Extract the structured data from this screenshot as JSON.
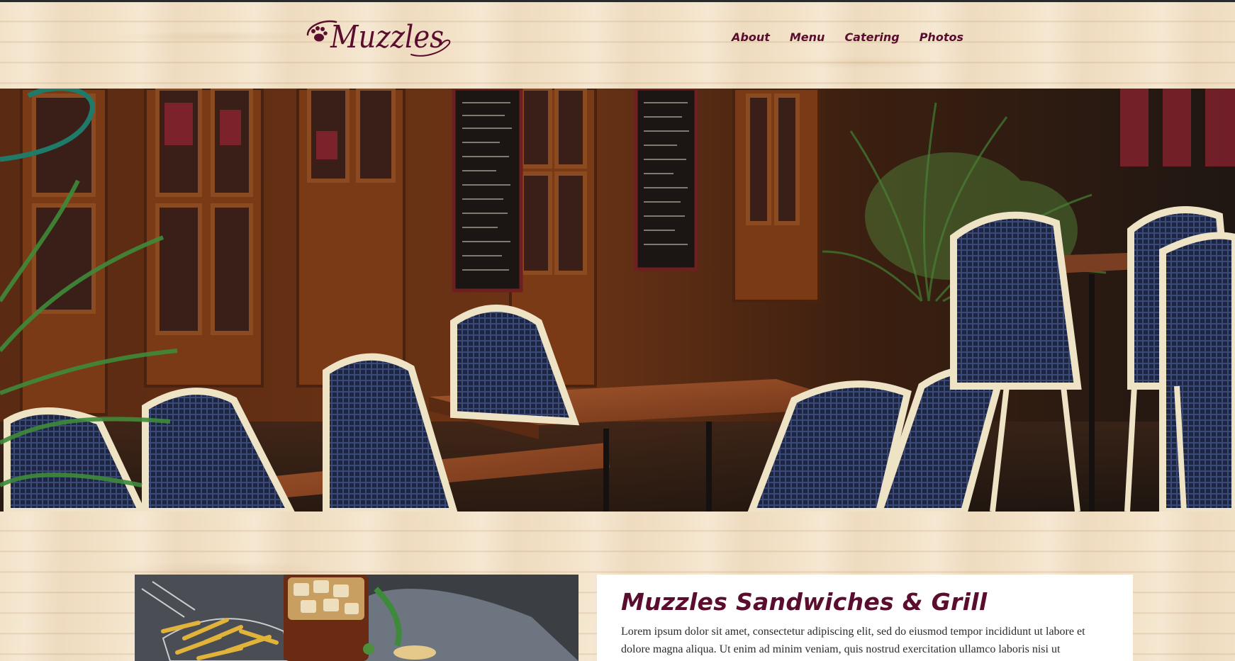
{
  "brand": {
    "name": "Muzzles",
    "color": "#5a0d2e",
    "logo_icon": "paw-print-icon"
  },
  "nav": {
    "items": [
      {
        "label": "About"
      },
      {
        "label": "Menu"
      },
      {
        "label": "Catering"
      },
      {
        "label": "Photos"
      }
    ]
  },
  "hero": {
    "image": "outdoor-cafe-terrace-photo"
  },
  "intro": {
    "title": "Muzzles Sandwiches & Grill",
    "body": "Lorem ipsum dolor sit amet, consectetur adipiscing elit, sed do eiusmod tempor incididunt ut labore et dolore magna aliqua. Ut enim ad minim veniam, quis nostrud exercitation ullamco laboris nisi ut",
    "image": "fries-and-iced-drink-photo"
  },
  "colors": {
    "background": "#f3e2c8",
    "accent": "#5a0d2e",
    "card": "#ffffff"
  }
}
